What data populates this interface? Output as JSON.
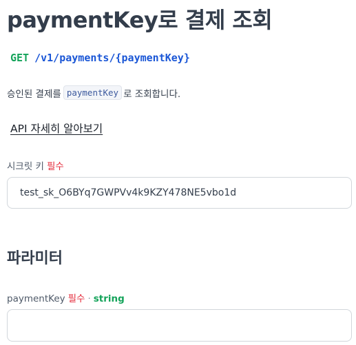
{
  "title": "paymentKey로 결제 조회",
  "endpoint": {
    "method": "GET",
    "path": "/v1/payments/{paymentKey}"
  },
  "description": {
    "before": "승인된 결제를",
    "code": "paymentKey",
    "after": "로 조회합니다."
  },
  "api_link": "API 자세히 알아보기",
  "secret_key": {
    "label": "시크릿 키",
    "required": "필수",
    "value": "test_sk_O6BYq7GWPVv4k9KZY478NE5vbo1d"
  },
  "parameters": {
    "title": "파라미터",
    "payment_key": {
      "label": "paymentKey",
      "required": "필수",
      "separator": "·",
      "type": "string",
      "value": ""
    }
  }
}
